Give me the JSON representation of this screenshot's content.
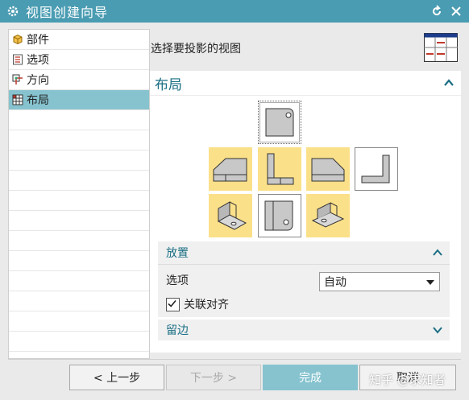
{
  "window": {
    "title": "视图创建向导"
  },
  "sidebar": {
    "items": [
      {
        "label": "部件",
        "icon": "part-cube-icon",
        "active": false
      },
      {
        "label": "选项",
        "icon": "options-list-icon",
        "active": false
      },
      {
        "label": "方向",
        "icon": "orientation-icon",
        "active": false
      },
      {
        "label": "布局",
        "icon": "layout-grid-icon",
        "active": true
      }
    ]
  },
  "main": {
    "instruction": "选择要投影的视图",
    "layout_panel": {
      "title": "布局",
      "placement": {
        "title": "放置",
        "option_label": "选项",
        "option_value": "自动",
        "associative_align_label": "关联对齐",
        "associative_align_checked": true
      },
      "margin": {
        "title": "留边"
      }
    }
  },
  "buttons": {
    "prev": "< 上一步",
    "next": "下一步 >",
    "finish": "完成",
    "cancel": "取消"
  },
  "watermark": "知乎 @求知者",
  "colors": {
    "titlebar": "#4a9cb2",
    "accent_text": "#1a6f84",
    "selected": "#86c3cf",
    "view_selected": "#fbe08a"
  }
}
